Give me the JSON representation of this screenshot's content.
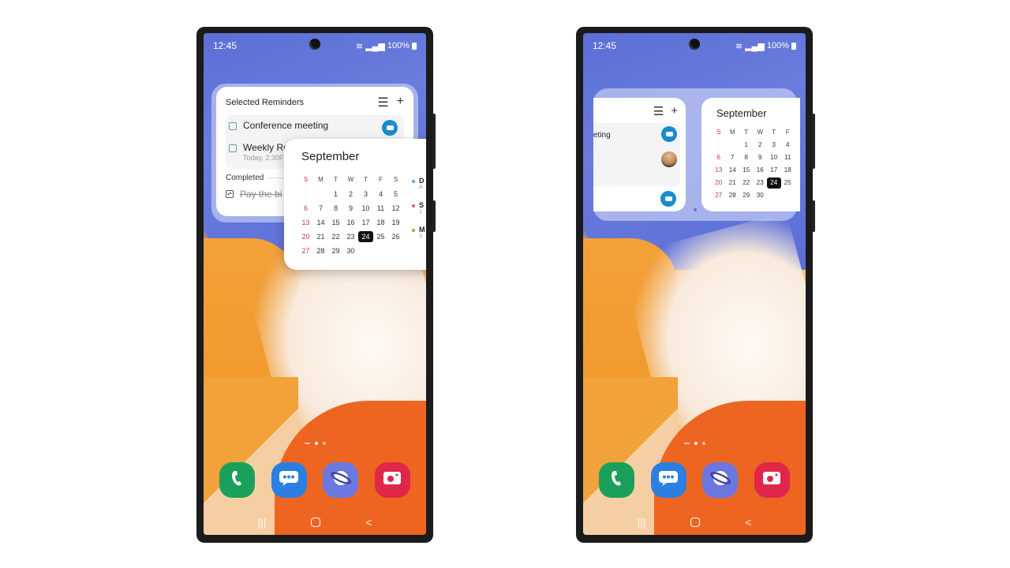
{
  "phones": [
    {
      "status": {
        "time": "12:45",
        "battery": "100%"
      },
      "reminders": {
        "title": "Selected Reminders",
        "items": [
          {
            "title": "Conference meeting",
            "subtitle": ""
          },
          {
            "title": "Weekly Re",
            "subtitle": "Today, 2:30F"
          }
        ],
        "completed_label": "Completed",
        "completed_items": [
          {
            "title": "Pay the bi"
          }
        ]
      },
      "calendar": {
        "month": "September",
        "weekdays": [
          "S",
          "M",
          "T",
          "W",
          "T",
          "F",
          "S"
        ],
        "weeks": [
          [
            "",
            "",
            "1",
            "2",
            "3",
            "4",
            "5"
          ],
          [
            "6",
            "7",
            "8",
            "9",
            "10",
            "11",
            "12"
          ],
          [
            "13",
            "14",
            "15",
            "16",
            "17",
            "18",
            "19"
          ],
          [
            "20",
            "21",
            "22",
            "23",
            "24",
            "25",
            "26"
          ],
          [
            "27",
            "28",
            "29",
            "30",
            "",
            "",
            ""
          ]
        ],
        "today": "24",
        "events": [
          {
            "initial": "D",
            "sub": "A",
            "color": "#6aa0d0"
          },
          {
            "initial": "S",
            "sub": "1",
            "color": "#d06080"
          },
          {
            "initial": "M",
            "sub": "3",
            "color": "#9aaa40"
          }
        ]
      }
    },
    {
      "status": {
        "time": "12:45",
        "battery": "100%"
      },
      "reminders": {
        "visible_item": "eting"
      },
      "calendar": {
        "month": "September",
        "weekdays": [
          "S",
          "M",
          "T",
          "W",
          "T",
          "F"
        ],
        "weeks": [
          [
            "",
            "",
            "1",
            "2",
            "3",
            "4"
          ],
          [
            "6",
            "7",
            "8",
            "9",
            "10",
            "11"
          ],
          [
            "13",
            "14",
            "15",
            "16",
            "17",
            "18"
          ],
          [
            "20",
            "21",
            "22",
            "23",
            "24",
            "25"
          ],
          [
            "27",
            "28",
            "29",
            "30",
            "",
            ""
          ]
        ],
        "today": "24"
      }
    }
  ],
  "dock": [
    {
      "name": "Phone",
      "icon": "phone-icon",
      "color": "#1aa05a"
    },
    {
      "name": "Messages",
      "icon": "message-icon",
      "color": "#2a7fe0"
    },
    {
      "name": "Internet",
      "icon": "internet-icon",
      "color": "#6a78e0"
    },
    {
      "name": "Camera",
      "icon": "camera-icon",
      "color": "#e0274a"
    }
  ],
  "nav": {
    "recents": "|||",
    "back": "<"
  }
}
